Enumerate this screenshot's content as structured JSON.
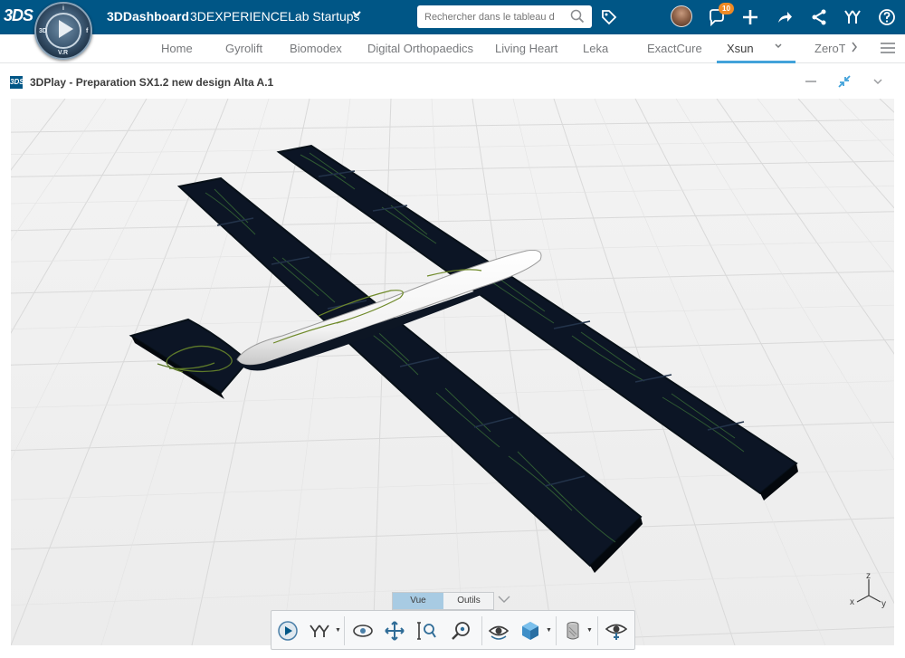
{
  "topbar": {
    "logo_text": "3DS",
    "compass_labels": {
      "top": "i",
      "left": "3D",
      "right": "f",
      "bottom": "V.R"
    },
    "brand": "3DDashboard",
    "platform": "3DEXPERIENCELab Startups",
    "search_placeholder": "Rechercher dans le tableau d",
    "notification_count": "10",
    "colors": {
      "bar": "#005686",
      "badge": "#f08a24"
    }
  },
  "tabs": {
    "items": [
      {
        "label": "Home"
      },
      {
        "label": "Gyrolift"
      },
      {
        "label": "Biomodex"
      },
      {
        "label": "Digital Orthopaedics"
      },
      {
        "label": "Living Heart"
      },
      {
        "label": "Leka"
      },
      {
        "label": "ExactCure"
      },
      {
        "label": "Xsun"
      },
      {
        "label": "ZeroT"
      }
    ],
    "active": "Xsun",
    "accent": "#42a2da"
  },
  "widget": {
    "icon_text": "3DS",
    "title": "3DPlay - Preparation SX1.2 new design Alta A.1"
  },
  "viewer": {
    "mode_tabs": [
      {
        "label": "Vue",
        "active": true
      },
      {
        "label": "Outils",
        "active": false
      }
    ],
    "tools": [
      "play-icon",
      "compass-ar-icon",
      "orbit-icon",
      "pan-icon",
      "zoom-icon",
      "zoom-area-icon",
      "view-icon",
      "cube-view-icon",
      "section-icon",
      "visibility-icon"
    ],
    "axis": {
      "x": "x",
      "y": "y",
      "z": "z"
    }
  }
}
